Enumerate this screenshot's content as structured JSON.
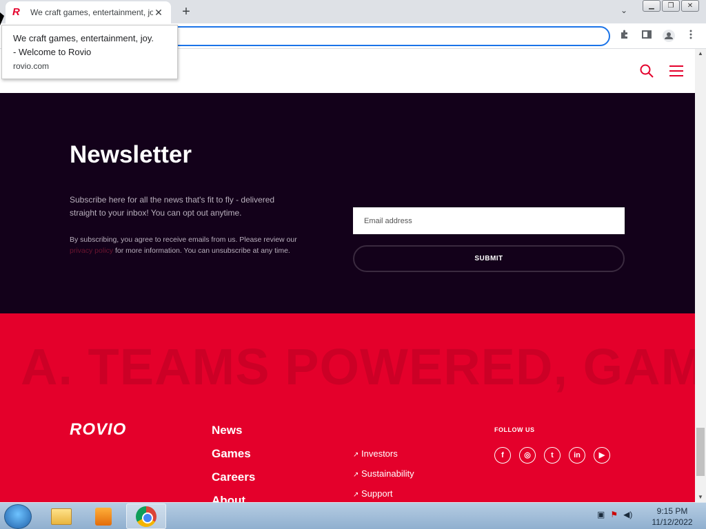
{
  "browser": {
    "tab_title": "We craft games, entertainment, joy. - Welcome to Rovio",
    "tab_favicon": "R",
    "tab_close": "✕",
    "new_tab": "+",
    "tab_list": "⌄",
    "window_controls": {
      "minimize": "▁",
      "restore": "❐",
      "close": "✕"
    },
    "toolbar_icons": {
      "extensions": "puzzle-icon",
      "sidepanel": "sidepanel-icon",
      "profile": "profile-icon",
      "menu": "kebab-icon"
    }
  },
  "tooltip": {
    "line1": "We craft games, entertainment, joy.",
    "line2": "- Welcome to Rovio",
    "url": "rovio.com"
  },
  "newsletter": {
    "title": "Newsletter",
    "description": "Subscribe here for all the news that's fit to fly - delivered straight to your inbox! You can opt out anytime.",
    "legal_prefix": "By subscribing, you agree to receive emails from us. Please review our ",
    "legal_link": "privacy policy",
    "legal_suffix": " for more information. You can unsubscribe at any time.",
    "email_placeholder": "Email address",
    "submit_label": "SUBMIT"
  },
  "footer": {
    "marquee": "A. TEAMS POWERED, GAMES",
    "logo": "ROVIO",
    "main_nav": [
      "News",
      "Games",
      "Careers",
      "About"
    ],
    "secondary_nav": [
      "Investors",
      "Sustainability",
      "Support"
    ],
    "arrow": "↗",
    "follow_label": "FOLLOW US",
    "socials": [
      "f",
      "◎",
      "t",
      "in",
      "▶"
    ]
  },
  "taskbar": {
    "time": "9:15 PM",
    "date": "11/12/2022"
  },
  "colors": {
    "brand": "#e4002b",
    "dark": "#13011a"
  }
}
